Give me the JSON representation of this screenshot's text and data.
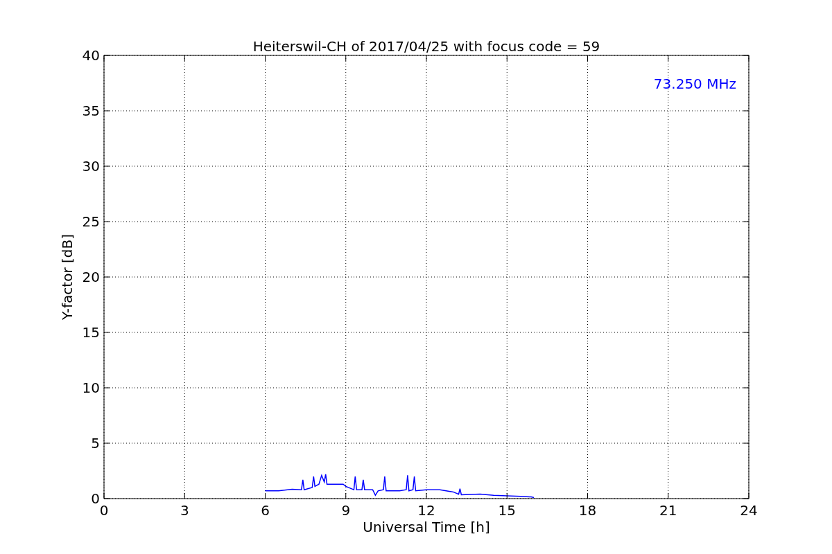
{
  "chart_data": {
    "type": "line",
    "title": "Heiterswil-CH of 2017/04/25 with focus code = 59",
    "xlabel": "Universal Time [h]",
    "ylabel": "Y-factor [dB]",
    "x": [
      6,
      6.5,
      7,
      7.35,
      7.4,
      7.45,
      7.75,
      7.8,
      7.85,
      8,
      8.1,
      8.2,
      8.25,
      8.3,
      8.9,
      9.0,
      9.3,
      9.35,
      9.4,
      9.6,
      9.65,
      9.7,
      10,
      10.1,
      10.2,
      10.4,
      10.45,
      10.5,
      11,
      11.25,
      11.3,
      11.35,
      11.5,
      11.55,
      11.6,
      12,
      12.5,
      13,
      13.2,
      13.25,
      13.3,
      14,
      14.5,
      15,
      15.5,
      15.9,
      16
    ],
    "series": [
      {
        "name": "73.250 MHz",
        "color": "#0000ff",
        "values": [
          0.7,
          0.7,
          0.85,
          0.8,
          1.7,
          0.8,
          1.0,
          2.0,
          1.1,
          1.3,
          2.1,
          1.5,
          2.2,
          1.3,
          1.3,
          1.1,
          0.8,
          2.0,
          0.8,
          0.8,
          1.7,
          0.8,
          0.8,
          0.3,
          0.7,
          0.8,
          2.0,
          0.7,
          0.7,
          0.8,
          2.1,
          0.7,
          0.8,
          2.0,
          0.7,
          0.8,
          0.8,
          0.6,
          0.4,
          0.9,
          0.35,
          0.4,
          0.3,
          0.25,
          0.2,
          0.15,
          0.1
        ]
      }
    ],
    "xlim": [
      0,
      24
    ],
    "ylim": [
      0,
      40
    ],
    "xticks": [
      0,
      3,
      6,
      9,
      12,
      15,
      18,
      21,
      24
    ],
    "yticks": [
      0,
      5,
      10,
      15,
      20,
      25,
      30,
      35,
      40
    ],
    "grid": true
  }
}
